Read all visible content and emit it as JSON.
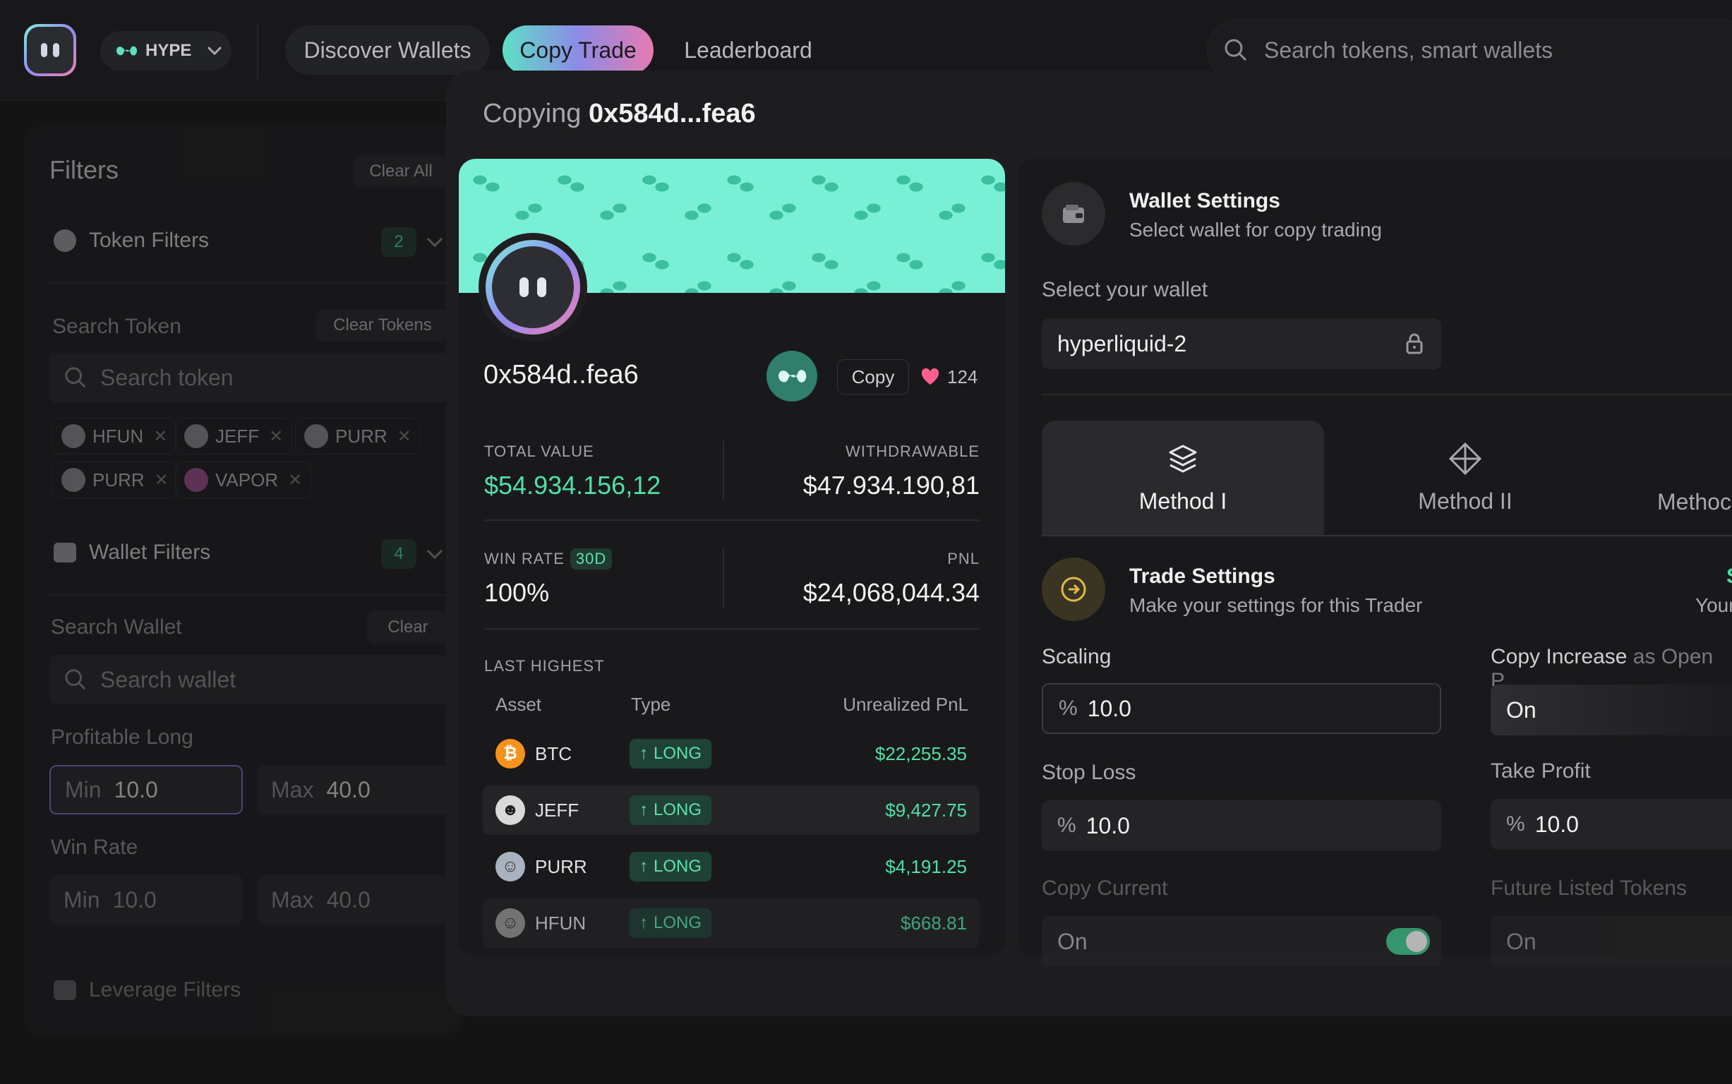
{
  "topbar": {
    "network_label": "HYPE",
    "nav": [
      {
        "label": "Discover Wallets"
      },
      {
        "label": "Copy Trade"
      },
      {
        "label": "Leaderboard"
      }
    ],
    "search_placeholder": "Search tokens, smart wallets"
  },
  "filters": {
    "title": "Filters",
    "clear_all": "Clear All",
    "token_filters": {
      "label": "Token Filters",
      "count": "2"
    },
    "search_token": {
      "label": "Search Token",
      "clear": "Clear Tokens",
      "placeholder": "Search token"
    },
    "tokens": [
      "HFUN",
      "JEFF",
      "PURR",
      "PURR",
      "VAPOR"
    ],
    "wallet_filters": {
      "label": "Wallet Filters",
      "count": "4"
    },
    "search_wallet": {
      "label": "Search Wallet",
      "clear": "Clear",
      "placeholder": "Search wallet"
    },
    "profitable_long": {
      "label": "Profitable Long",
      "min_label": "Min",
      "min": "10.0",
      "max_label": "Max",
      "max": "40.0"
    },
    "win_rate": {
      "label": "Win Rate",
      "min_label": "Min",
      "min": "10.0",
      "max_label": "Max",
      "max": "40.0"
    },
    "leverage_filters": {
      "label": "Leverage Filters"
    }
  },
  "modal": {
    "title_prefix": "Copying",
    "title_address": "0x584d...fea6"
  },
  "trader": {
    "address": "0x584d..fea6",
    "copy_label": "Copy",
    "likes": "124",
    "total_value_label": "TOTAL VALUE",
    "total_value": "$54.934.156,12",
    "withdrawable_label": "WITHDRAWABLE",
    "withdrawable": "$47.934.190,81",
    "win_rate_label": "WIN RATE",
    "win_rate_period": "30D",
    "win_rate": "100%",
    "pnl_label": "PNL",
    "pnl": "$24,068,044.34",
    "last_highest_label": "LAST HIGHEST",
    "table_headers": [
      "Asset",
      "Type",
      "Unrealized PnL"
    ],
    "positions": [
      {
        "asset": "BTC",
        "type": "LONG",
        "pnl": "$22,255.35",
        "color": "#f7931a"
      },
      {
        "asset": "JEFF",
        "type": "LONG",
        "pnl": "$9,427.75",
        "color": "#d9d9d9"
      },
      {
        "asset": "PURR",
        "type": "LONG",
        "pnl": "$4,191.25",
        "color": "#a8b3bf"
      },
      {
        "asset": "HFUN",
        "type": "LONG",
        "pnl": "$668.81",
        "color": "#9a9a9a"
      }
    ]
  },
  "settings": {
    "wallet_settings_title": "Wallet Settings",
    "wallet_settings_sub": "Select wallet for copy trading",
    "select_wallet_label": "Select your wallet",
    "wallet_value": "hyperliquid-2",
    "methods": [
      "Method I",
      "Method II",
      "Methoc"
    ],
    "trade_settings_title": "Trade Settings",
    "trade_settings_sub": "Make your settings for this Trader",
    "right_hint_top": "S",
    "right_hint_sub": "Your",
    "scaling_label": "Scaling",
    "scaling_value": "10.0",
    "copy_increase_label_a": "Copy Increase",
    "copy_increase_label_b": "as Open P",
    "copy_increase_value": "On",
    "stop_loss_label": "Stop Loss",
    "stop_loss_value": "10.0",
    "take_profit_label": "Take Profit",
    "take_profit_value": "10.0",
    "copy_current_label": "Copy Current",
    "copy_current_value": "On",
    "future_listed_label": "Future Listed Tokens",
    "future_listed_value": "On",
    "pct_symbol": "%"
  },
  "colors": {
    "accent_green": "#4fe0a5",
    "banner": "#79f0d6",
    "like": "#ff5f8f"
  }
}
